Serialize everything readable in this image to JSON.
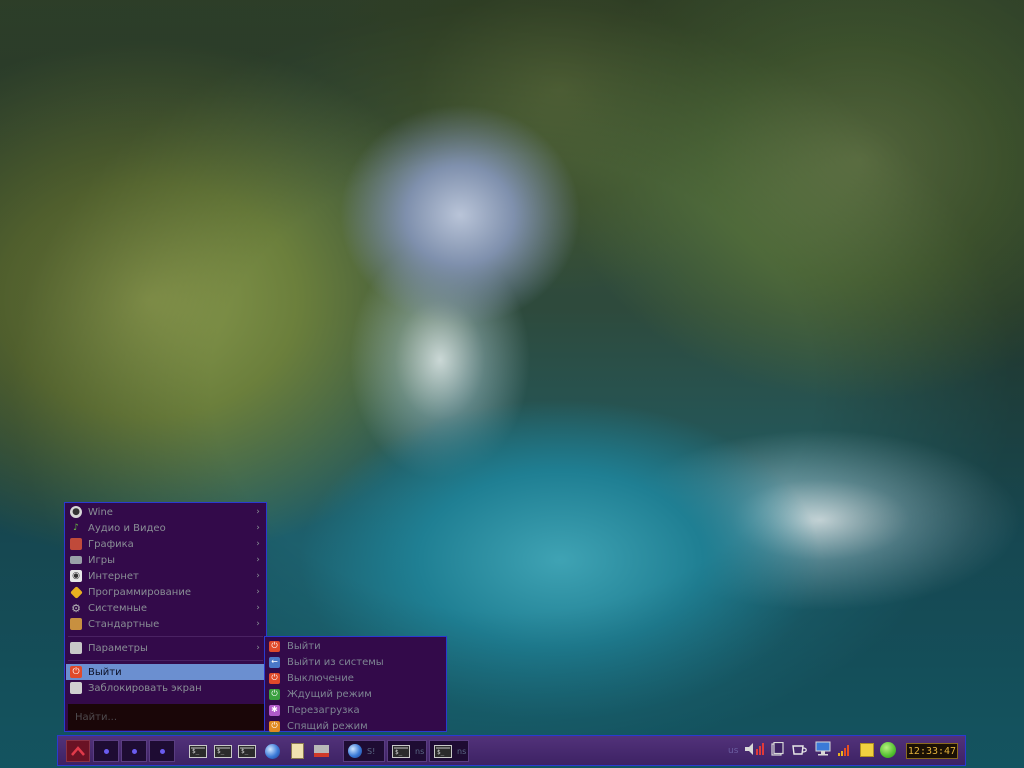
{
  "menu": {
    "categories": [
      {
        "label": "Wine",
        "icon": "wine-icon"
      },
      {
        "label": "Аудио и Видео",
        "icon": "music-note-icon"
      },
      {
        "label": "Графика",
        "icon": "graphics-icon"
      },
      {
        "label": "Игры",
        "icon": "gamepad-icon"
      },
      {
        "label": "Интернет",
        "icon": "internet-icon"
      },
      {
        "label": "Программирование",
        "icon": "programming-icon"
      },
      {
        "label": "Системные",
        "icon": "gear-icon"
      },
      {
        "label": "Стандартные",
        "icon": "accessories-icon"
      }
    ],
    "settings_label": "Параметры",
    "logout_label": "Выйти",
    "lock_label": "Заблокировать экран",
    "search_placeholder": "Найти..."
  },
  "submenu": {
    "items": [
      {
        "label": "Выйти",
        "icon": "power-icon",
        "color": "#e04a2a"
      },
      {
        "label": "Выйти из системы",
        "icon": "logout-arrow-icon",
        "color": "#4a78c8"
      },
      {
        "label": "Выключение",
        "icon": "shutdown-icon",
        "color": "#e04a2a"
      },
      {
        "label": "Ждущий режим",
        "icon": "standby-icon",
        "color": "#3aa040"
      },
      {
        "label": "Перезагрузка",
        "icon": "reboot-icon",
        "color": "#b05ac8"
      },
      {
        "label": "Спящий режим",
        "icon": "hibernate-icon",
        "color": "#e08a20"
      }
    ]
  },
  "taskbar": {
    "workspace_count": 3,
    "tasks": [
      {
        "label": "S!",
        "icon": "globe-icon"
      },
      {
        "label": "ns",
        "icon": "terminal-icon"
      },
      {
        "label": "ns",
        "icon": "terminal-icon"
      }
    ],
    "keyboard_layout": "us",
    "clock": "12:33:47"
  },
  "colors": {
    "menu_bg": "#330a4a",
    "menu_border": "#2a3ad0",
    "selection": "#6b8fd0",
    "clock_text": "#e3b23c"
  }
}
